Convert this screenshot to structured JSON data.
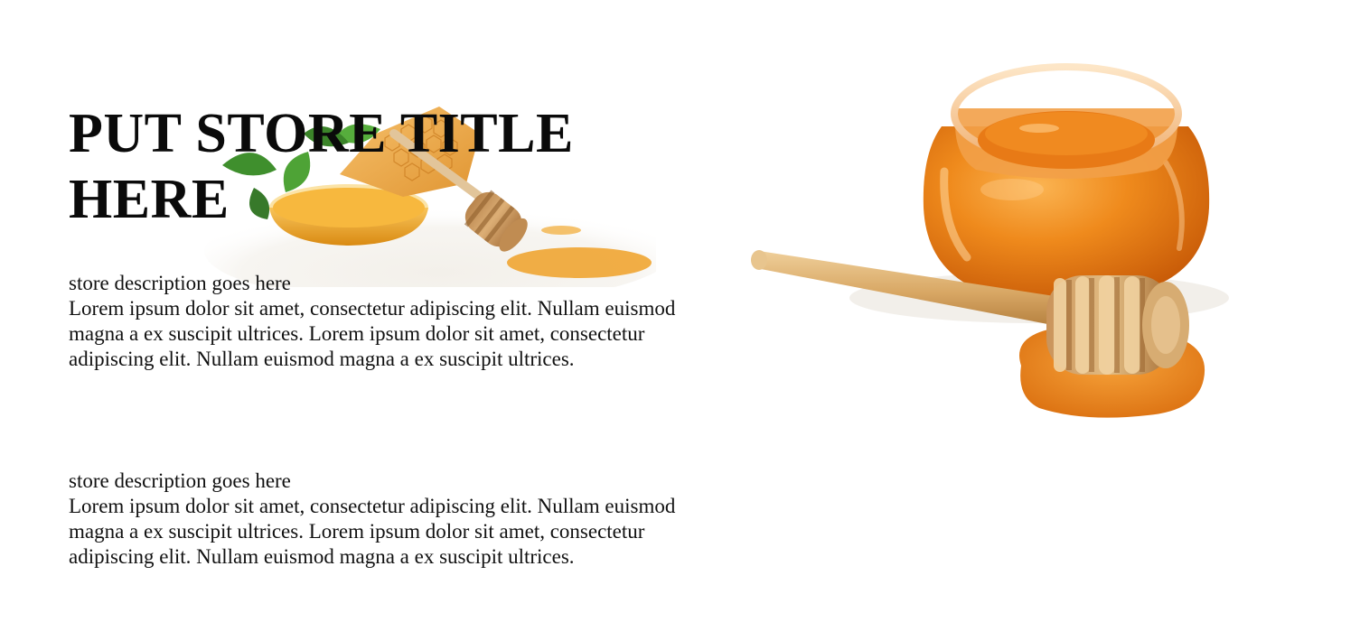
{
  "store": {
    "title": "PUT STORE TITLE HERE"
  },
  "sections": [
    {
      "heading": "store description goes here",
      "body": "Lorem ipsum dolor sit amet, consectetur adipiscing elit. Nullam euismod magna a ex suscipit ultrices. Lorem ipsum dolor sit amet, consectetur adipiscing elit. Nullam euismod magna a ex suscipit ultrices."
    },
    {
      "heading": "store description goes here",
      "body": "Lorem ipsum dolor sit amet, consectetur adipiscing elit. Nullam euismod magna a ex suscipit ultrices. Lorem ipsum dolor sit amet, consectetur adipiscing elit. Nullam euismod magna a ex suscipit ultrices."
    }
  ],
  "colors": {
    "honey": "#e8870f",
    "honey_light": "#f6b04a",
    "honey_dark": "#c2610a",
    "wood": "#d9a867",
    "wood_dark": "#a5723a",
    "leaf": "#3f8f2d",
    "background": "#ffffff",
    "text": "#111111"
  }
}
